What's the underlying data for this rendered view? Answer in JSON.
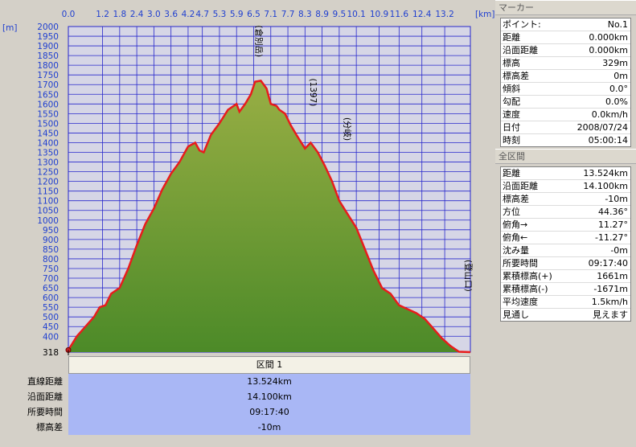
{
  "chart_data": {
    "type": "area",
    "x_unit": "[km]",
    "y_unit": "[m]",
    "x_ticks": [
      "0.0",
      "1.2",
      "1.8",
      "2.4",
      "3.0",
      "3.6",
      "4.2",
      "4.7",
      "5.3",
      "5.9",
      "6.5",
      "7.1",
      "7.7",
      "8.3",
      "8.9",
      "9.5",
      "10.1",
      "10.9",
      "11.6",
      "12.4",
      "13.2"
    ],
    "xlim": [
      0,
      14.1
    ],
    "ylim": [
      318,
      2000
    ],
    "y_ticks": [
      2000,
      1950,
      1900,
      1850,
      1800,
      1750,
      1700,
      1650,
      1600,
      1550,
      1500,
      1450,
      1400,
      1350,
      1300,
      1250,
      1200,
      1150,
      1100,
      1050,
      1000,
      950,
      900,
      850,
      800,
      750,
      700,
      650,
      600,
      550,
      500,
      450,
      400
    ],
    "y_min_label": "318",
    "x": [
      0,
      0.3,
      0.6,
      0.9,
      1.1,
      1.3,
      1.5,
      1.8,
      2.1,
      2.4,
      2.7,
      3.0,
      3.3,
      3.6,
      3.9,
      4.2,
      4.45,
      4.6,
      4.75,
      5.0,
      5.3,
      5.6,
      5.9,
      6.0,
      6.2,
      6.4,
      6.55,
      6.75,
      6.95,
      7.1,
      7.3,
      7.4,
      7.6,
      7.8,
      8.0,
      8.3,
      8.5,
      8.75,
      9.0,
      9.25,
      9.5,
      9.8,
      10.1,
      10.4,
      10.7,
      11.0,
      11.3,
      11.6,
      11.9,
      12.2,
      12.5,
      12.8,
      13.1,
      13.4,
      13.7,
      14.1
    ],
    "y": [
      329,
      400,
      450,
      500,
      550,
      560,
      620,
      650,
      750,
      870,
      980,
      1060,
      1160,
      1240,
      1300,
      1380,
      1400,
      1360,
      1350,
      1440,
      1500,
      1570,
      1600,
      1560,
      1600,
      1650,
      1715,
      1720,
      1680,
      1600,
      1590,
      1570,
      1550,
      1490,
      1440,
      1370,
      1400,
      1350,
      1280,
      1200,
      1100,
      1030,
      960,
      850,
      740,
      650,
      620,
      560,
      540,
      520,
      490,
      440,
      390,
      350,
      320,
      318
    ],
    "series": [
      {
        "values_ref": "y"
      }
    ],
    "annotations": [
      {
        "label": "(倉別岳)",
        "x": 6.7,
        "y": 1720
      },
      {
        "label": "(1397)",
        "x": 8.6,
        "y": 1400
      },
      {
        "label": "(分岐)",
        "x": 9.8,
        "y": 1290
      },
      {
        "label": "(登山口)",
        "x": 14.1,
        "y": 318
      }
    ],
    "grid": true,
    "line_color": "#e81c1c",
    "fill_top_color": "#98ae44",
    "fill_bottom_color": "#4c8a28",
    "plot_bg": "#d6d6e6",
    "grid_color": "#2828cc"
  },
  "section": {
    "header": "区間 1"
  },
  "summary": [
    {
      "label": "直線距離",
      "value": "13.524km"
    },
    {
      "label": "沿面距離",
      "value": "14.100km"
    },
    {
      "label": "所要時間",
      "value": "09:17:40"
    },
    {
      "label": "標高差",
      "value": "-10m"
    }
  ],
  "marker": {
    "title": "マーカー",
    "rows": [
      {
        "label": "ポイント:",
        "value": "No.1"
      },
      {
        "label": "距離",
        "value": "0.000km"
      },
      {
        "label": "沿面距離",
        "value": "0.000km"
      },
      {
        "label": "標高",
        "value": "329m"
      },
      {
        "label": "標高差",
        "value": "0m"
      },
      {
        "label": "傾斜",
        "value": "0.0°"
      },
      {
        "label": "勾配",
        "value": "0.0%"
      },
      {
        "label": "速度",
        "value": "0.0km/h"
      },
      {
        "label": "日付",
        "value": "2008/07/24"
      },
      {
        "label": "時刻",
        "value": "05:00:14"
      }
    ]
  },
  "all_section": {
    "title": "全区間",
    "rows": [
      {
        "label": "距離",
        "value": "13.524km"
      },
      {
        "label": "沿面距離",
        "value": "14.100km"
      },
      {
        "label": "標高差",
        "value": "-10m"
      },
      {
        "label": "方位",
        "value": "44.36°"
      },
      {
        "label": "俯角→",
        "value": "11.27°"
      },
      {
        "label": "俯角←",
        "value": "-11.27°"
      },
      {
        "label": "沈み量",
        "value": "-0m"
      },
      {
        "label": "所要時間",
        "value": "09:17:40"
      },
      {
        "label": "累積標高(+)",
        "value": "1661m"
      },
      {
        "label": "累積標高(-)",
        "value": "-1671m"
      },
      {
        "label": "平均速度",
        "value": "1.5km/h"
      },
      {
        "label": "見通し",
        "value": "見えます"
      }
    ]
  }
}
